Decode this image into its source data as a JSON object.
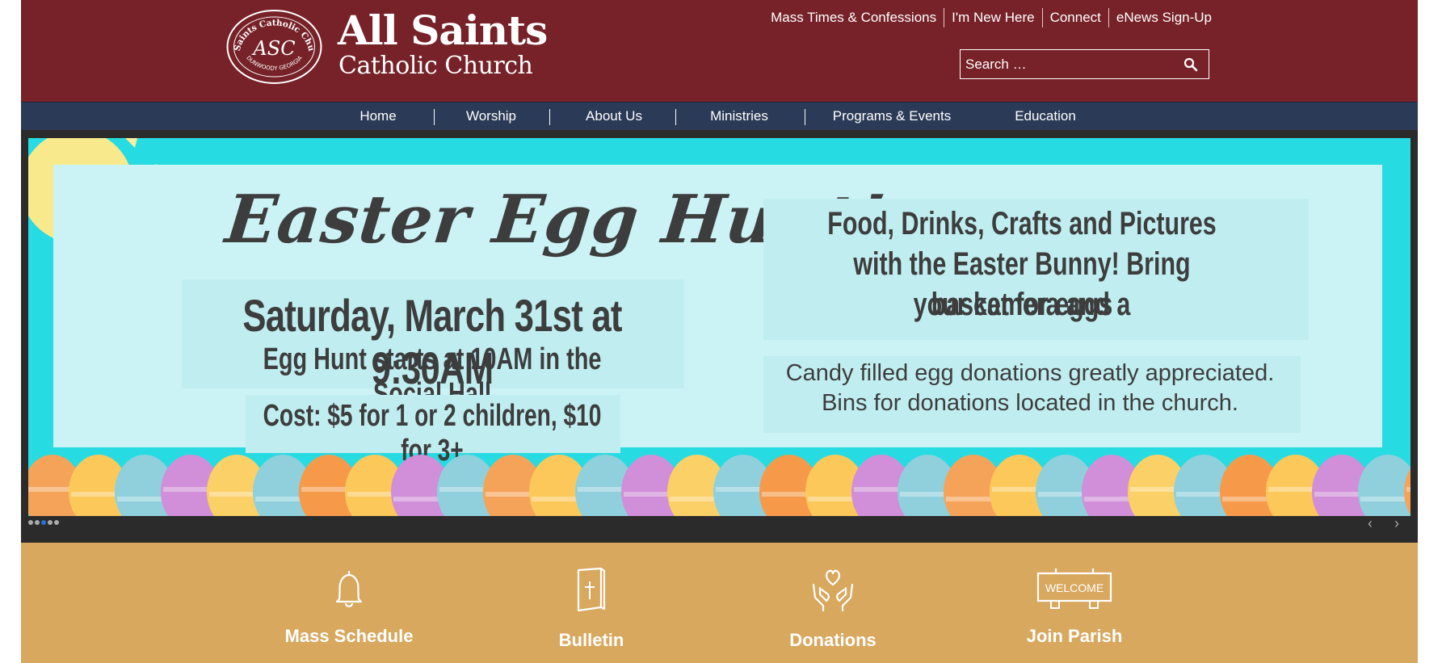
{
  "brand": {
    "seal_text_top": "All Saints Catholic Church",
    "seal_monogram": "ASC",
    "seal_text_bottom": "DUNWOODY GEORGIA",
    "name": "All Saints",
    "subtitle": "Catholic Church"
  },
  "top_links": [
    "Mass Times & Confessions",
    "I'm New Here",
    "Connect",
    "eNews Sign-Up"
  ],
  "search": {
    "placeholder": "Search …",
    "icon": "search-icon"
  },
  "nav": {
    "items": [
      "Home",
      "Worship",
      "About Us",
      "Ministries",
      "Programs & Events",
      "Education"
    ]
  },
  "slide": {
    "title": "Easter Egg Hunt!",
    "date": "Saturday, March 31st at 9:30AM",
    "start": "Egg Hunt starts at 10AM in the Social Hall",
    "cost": "Cost: $5 for 1 or 2 children, $10 for 3+",
    "info_lines": [
      "Food, Drinks, Crafts and Pictures",
      "with the Easter Bunny! Bring your camera and a",
      "basket for eggs"
    ],
    "donate_lines": [
      "Candy filled egg donations greatly appreciated.",
      "Bins for donations located in the church."
    ]
  },
  "slider": {
    "dot_count": 5,
    "active_dot": 3,
    "prev_label": "‹",
    "next_label": "›"
  },
  "quick_links": [
    {
      "label": "Mass Schedule",
      "icon": "bell-icon"
    },
    {
      "label": "Bulletin",
      "icon": "bulletin-book-icon"
    },
    {
      "label": "Donations",
      "icon": "heart-hands-icon"
    },
    {
      "label": "Join Parish",
      "icon": "welcome-sign-icon",
      "sign_text": "WELCOME"
    }
  ],
  "colors": {
    "header": "#762228",
    "nav": "#2b3a56",
    "slide_bg": "#27dbe2",
    "panel": "#cbf3f6",
    "quick_bg": "#d8a85f"
  }
}
